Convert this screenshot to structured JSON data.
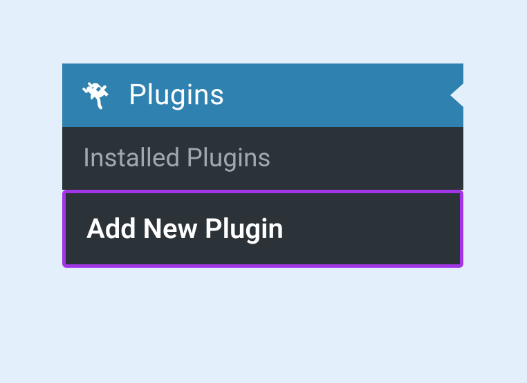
{
  "menu": {
    "header": {
      "label": "Plugins",
      "icon": "plug-icon"
    },
    "items": [
      {
        "label": "Installed Plugins",
        "active": false,
        "highlighted": false
      },
      {
        "label": "Add New Plugin",
        "active": true,
        "highlighted": true
      }
    ]
  },
  "colors": {
    "header_bg": "#2f81b0",
    "submenu_bg": "#2c3338",
    "inactive_text": "#a0a8ae",
    "highlight_border": "#a236e6",
    "page_bg": "#e4effc"
  }
}
